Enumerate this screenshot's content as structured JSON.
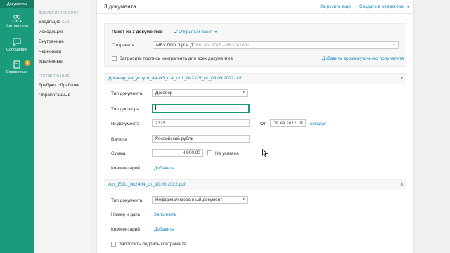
{
  "rail": {
    "items": [
      {
        "label": "Документы"
      },
      {
        "label": "Контрагенты"
      },
      {
        "label": "Сообщения"
      },
      {
        "label": "Справочная",
        "badge": "5"
      }
    ]
  },
  "sidebar": {
    "section1": "ДОКУМЕНТООБОРОТ",
    "incoming": "Входящие",
    "incoming_count": "112",
    "outgoing": "Исходящие",
    "internal": "Внутренние",
    "drafts": "Черновики",
    "deleted": "Удаленные",
    "section2": "СОГЛАСОВАНИЕ",
    "needs_processing": "Требуют обработки",
    "processed": "Обработанные"
  },
  "header": {
    "title": "3 документа",
    "upload_more": "Загрузить еще",
    "create_in_editor": "Создать в редакторе"
  },
  "package": {
    "title": "Пакет из 3 документов",
    "open_package": "Открытый пакет",
    "send_label": "Отправить",
    "recipient_name": "МБУ ПГО \"ЦК и Д\"",
    "recipient_ids": "6613010016 – 663301001",
    "request_signature_all": "Запросить подпись контрагента для всех документов",
    "add_intermediate": "Добавить промежуточного получателя"
  },
  "doc1": {
    "filename": "Договор_на_услуги_44-ФЗ_п.4_ст.1_№2325_от_09.09.2022.pdf",
    "doc_type_label": "Тип документа",
    "doc_type_value": "Договор",
    "contract_type_label": "Тип договора",
    "contract_type_value": "",
    "number_label": "№ документа",
    "number_value": "2325",
    "from_label": "От",
    "date_value": "09.09.2022",
    "today": "сегодня",
    "currency_label": "Валюта",
    "currency_value": "Российский рубль",
    "sum_label": "Сумма",
    "sum_value": "4 900.00",
    "not_specified": "Не указана",
    "comment_label": "Комментарий",
    "add": "Добавить"
  },
  "doc2": {
    "filename": "Акт_EDU_№2404_от_10.09.2022.pdf",
    "doc_type_label": "Тип документа",
    "doc_type_value": "Неформализованный документ",
    "number_date_label": "Номер и дата",
    "fill": "Заполнить",
    "comment_label": "Комментарий",
    "add": "Добавить",
    "request_signature": "Запросить подпись контрагента"
  },
  "colors": {
    "rail": "#1a9b7c",
    "link": "#1a8cbc",
    "badge": "#f0a030"
  }
}
